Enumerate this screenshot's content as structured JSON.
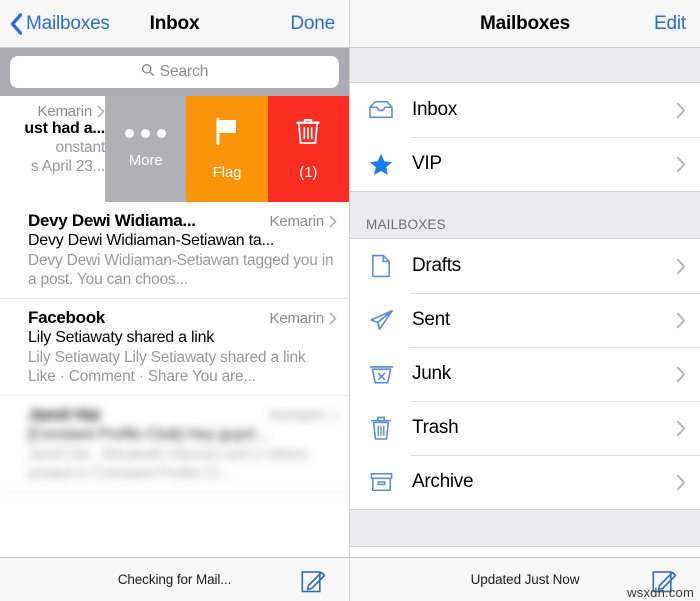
{
  "left": {
    "nav": {
      "back_label": "Mailboxes",
      "back_icon": "chevron-left-icon",
      "title": "Inbox",
      "right_label": "Done"
    },
    "search": {
      "placeholder": "Search",
      "icon": "search-icon"
    },
    "swipe_actions": [
      {
        "label": "More",
        "icon": "ellipsis-icon",
        "color": "#b0b0b5"
      },
      {
        "label": "Flag",
        "icon": "flag-icon",
        "color": "#fb9507"
      },
      {
        "label": "(1)",
        "icon": "trash-icon",
        "color": "#fb2c22"
      }
    ],
    "swiped_row": {
      "date": "Kemarin",
      "subject": "ust had a...",
      "preview_line1": "onstant",
      "preview_line2": "s April 23..."
    },
    "messages": [
      {
        "sender": "Devy Dewi Widiama...",
        "date": "Kemarin",
        "subject": "Devy Dewi Widiaman-Setiawan ta...",
        "preview": "Devy Dewi Widiaman-Setiawan tagged you in a post. You can choos...",
        "blurred": false
      },
      {
        "sender": "Facebook",
        "date": "Kemarin",
        "subject": "Lily Setiawaty shared a link",
        "preview": "Lily Setiawaty Lily Setiawaty shared a link Like · Comment · Share You are...",
        "blurred": false
      },
      {
        "sender": "Jamil Hai",
        "date": "Kemarin",
        "subject": "[Constant Profits Club] Hey guys!...",
        "preview": "Jamil Hai , Elizabeth Hanson and 2 others posted in Constant Profits Cl...",
        "blurred": true
      }
    ],
    "toolbar": {
      "status": "Checking for Mail...",
      "compose_icon": "compose-icon"
    }
  },
  "right": {
    "nav": {
      "title": "Mailboxes",
      "right_label": "Edit"
    },
    "favorites": [
      {
        "label": "Inbox",
        "icon": "inbox-tray-icon"
      },
      {
        "label": "VIP",
        "icon": "star-icon"
      }
    ],
    "section_title": "MAILBOXES",
    "mailboxes": [
      {
        "label": "Drafts",
        "icon": "document-icon"
      },
      {
        "label": "Sent",
        "icon": "paper-plane-icon"
      },
      {
        "label": "Junk",
        "icon": "junk-bin-icon"
      },
      {
        "label": "Trash",
        "icon": "trash-icon"
      },
      {
        "label": "Archive",
        "icon": "archive-box-icon"
      }
    ],
    "toolbar": {
      "status": "Updated Just Now",
      "compose_icon": "compose-icon"
    }
  },
  "watermark": "wsxdn.com",
  "colors": {
    "tint": "#2b6cd4",
    "icon_blue": "#5a8fd0",
    "flag_orange": "#fb9507",
    "delete_red": "#fb2c22",
    "more_gray": "#b0b0b5",
    "group_bg": "#eaeaef"
  }
}
